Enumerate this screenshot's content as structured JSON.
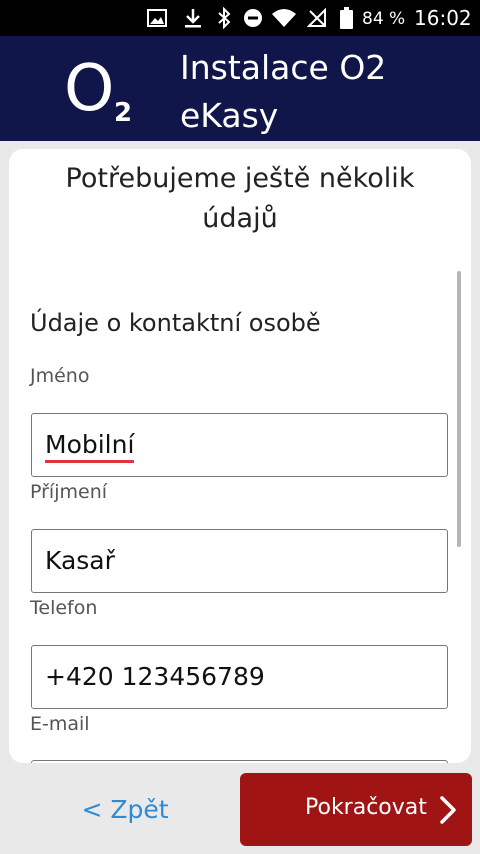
{
  "status_bar": {
    "battery_percent": "84 %",
    "time": "16:02",
    "icons": [
      "image-icon",
      "download-icon",
      "bluetooth-icon",
      "do-not-disturb-icon",
      "wifi-icon",
      "no-signal-icon",
      "battery-icon"
    ]
  },
  "header": {
    "logo_o": "O",
    "logo_2": "2",
    "title": "Instalace O2 eKasy"
  },
  "form": {
    "heading": "Potřebujeme ještě několik údajů",
    "section_title": "Údaje o kontaktní osobě",
    "fields": [
      {
        "label": "Jméno",
        "value": "Mobilní"
      },
      {
        "label": "Příjmení",
        "value": "Kasař"
      },
      {
        "label": "Telefon",
        "value": "+420 123456789"
      },
      {
        "label": "E-mail",
        "value": ""
      }
    ]
  },
  "footer": {
    "back_label": "< Zpět",
    "next_label": "Pokračovat"
  },
  "colors": {
    "header_bg": "#11164a",
    "next_button_bg": "#a01414",
    "back_link": "#2e8bd3",
    "spellcheck_underline": "#e0343a"
  }
}
